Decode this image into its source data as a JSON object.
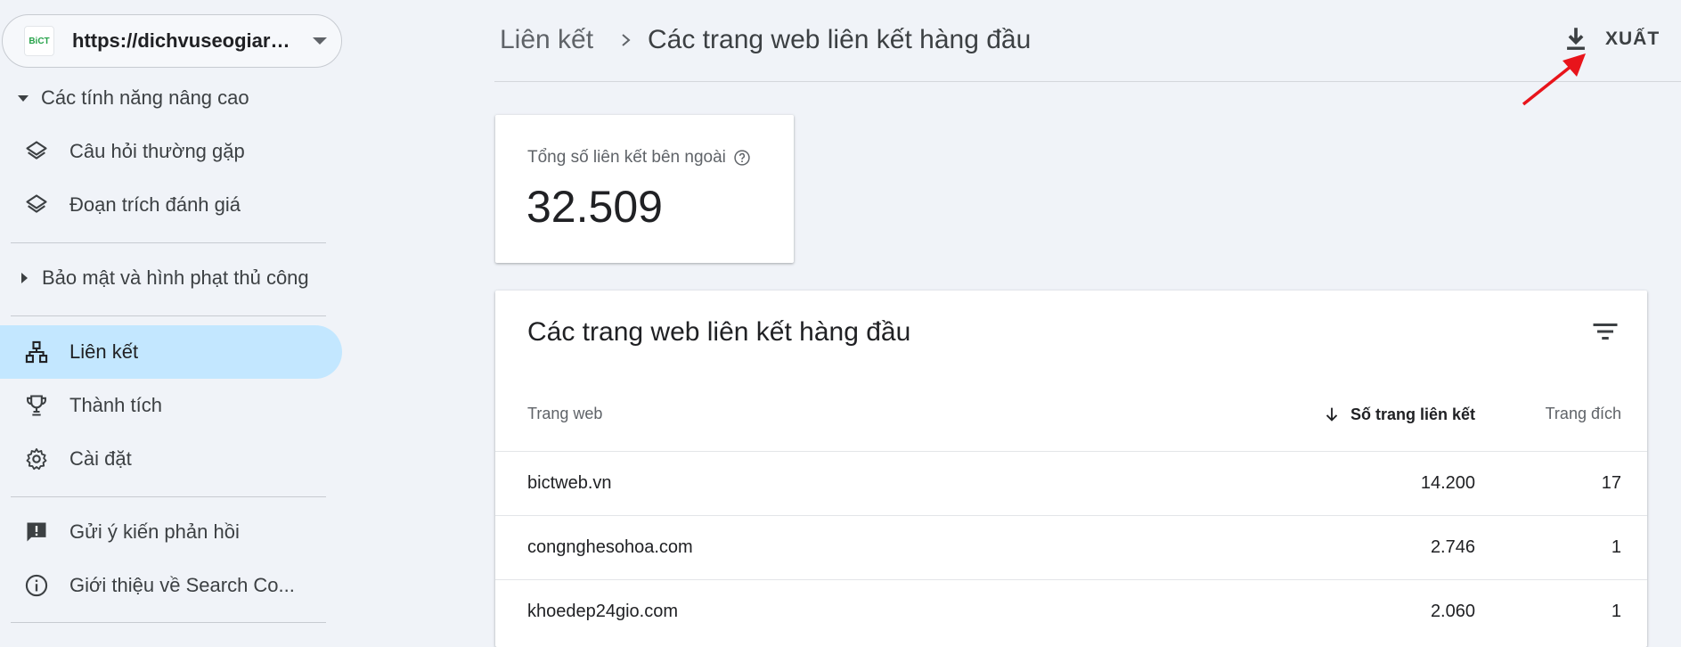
{
  "sidebar": {
    "property": {
      "logo_text": "BiCT",
      "url": "https://dichvuseogiareh..."
    },
    "group_advanced": "Các tính năng nâng cao",
    "items_advanced": [
      {
        "label": "Câu hỏi thường gặp",
        "icon": "layers-icon"
      },
      {
        "label": "Đoạn trích đánh giá",
        "icon": "layers-icon"
      }
    ],
    "group_security": "Bảo mật và hình phạt thủ công",
    "items_main": [
      {
        "label": "Liên kết",
        "icon": "links-tree-icon",
        "active": true
      },
      {
        "label": "Thành tích",
        "icon": "trophy-icon"
      },
      {
        "label": "Cài đặt",
        "icon": "gear-icon"
      }
    ],
    "items_footer": [
      {
        "label": "Gửi ý kiến phản hồi",
        "icon": "feedback-icon"
      },
      {
        "label": "Giới thiệu về Search Co...",
        "icon": "info-icon"
      }
    ]
  },
  "header": {
    "breadcrumb_parent": "Liên kết",
    "breadcrumb_current": "Các trang web liên kết hàng đầu",
    "export_label": "XUẤT"
  },
  "stat": {
    "label": "Tổng số liên kết bên ngoài",
    "value": "32.509"
  },
  "table": {
    "title": "Các trang web liên kết hàng đầu",
    "columns": [
      "Trang web",
      "Số trang liên kết",
      "Trang đích"
    ],
    "rows": [
      {
        "site": "bictweb.vn",
        "linking_pages": "14.200",
        "target_pages": "17"
      },
      {
        "site": "congnghesohoa.com",
        "linking_pages": "2.746",
        "target_pages": "1"
      },
      {
        "site": "khoedep24gio.com",
        "linking_pages": "2.060",
        "target_pages": "1"
      }
    ]
  },
  "colors": {
    "active_nav_bg": "#c3e7ff",
    "page_bg": "#f0f3f8",
    "annotation_arrow": "#e8141b"
  }
}
